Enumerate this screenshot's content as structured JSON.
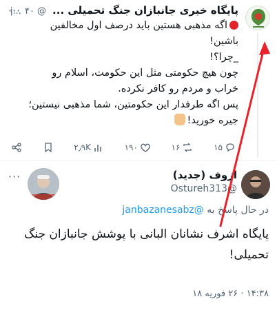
{
  "quoted_tweet": {
    "name": "پایگاه خبری جانبازان جنگ تحمیلی ...",
    "handle": "@j...",
    "time": "۴۰س",
    "lines": [
      "اگه مذهبی هستین باید درصف اول مخالفین",
      "باشین!",
      "_چرا؟!",
      "چون هیچ حکومتی مثل این حکومت، اسلام رو",
      "خراب و مردم رو کافر نکرده.",
      "پس اگه طرفدار این حکومتین، شما مذهبی نیستین؛",
      "جیره خورید!"
    ],
    "actions": {
      "replies": "۱۵",
      "retweets": "۱۶",
      "likes": "۱۹۰",
      "views": "۲٫۹K"
    }
  },
  "main_tweet": {
    "name": "ازوف (جدید)",
    "handle": "@Ostureh313",
    "reply_prefix": "در حال پاسخ به",
    "reply_mention": "@janbazanesabz",
    "text_line1": "پایگاه اشرف نشانان البانی با پوشش جانبازان جنگ",
    "text_line2": "تحمیلی!",
    "timestamp": "۱۴:۳۸ · ۲۶ فوریه ۱۸"
  },
  "colors": {
    "accent_blue": "#1d9bf0",
    "arrow_red": "#e8232b",
    "muted": "#536471"
  }
}
